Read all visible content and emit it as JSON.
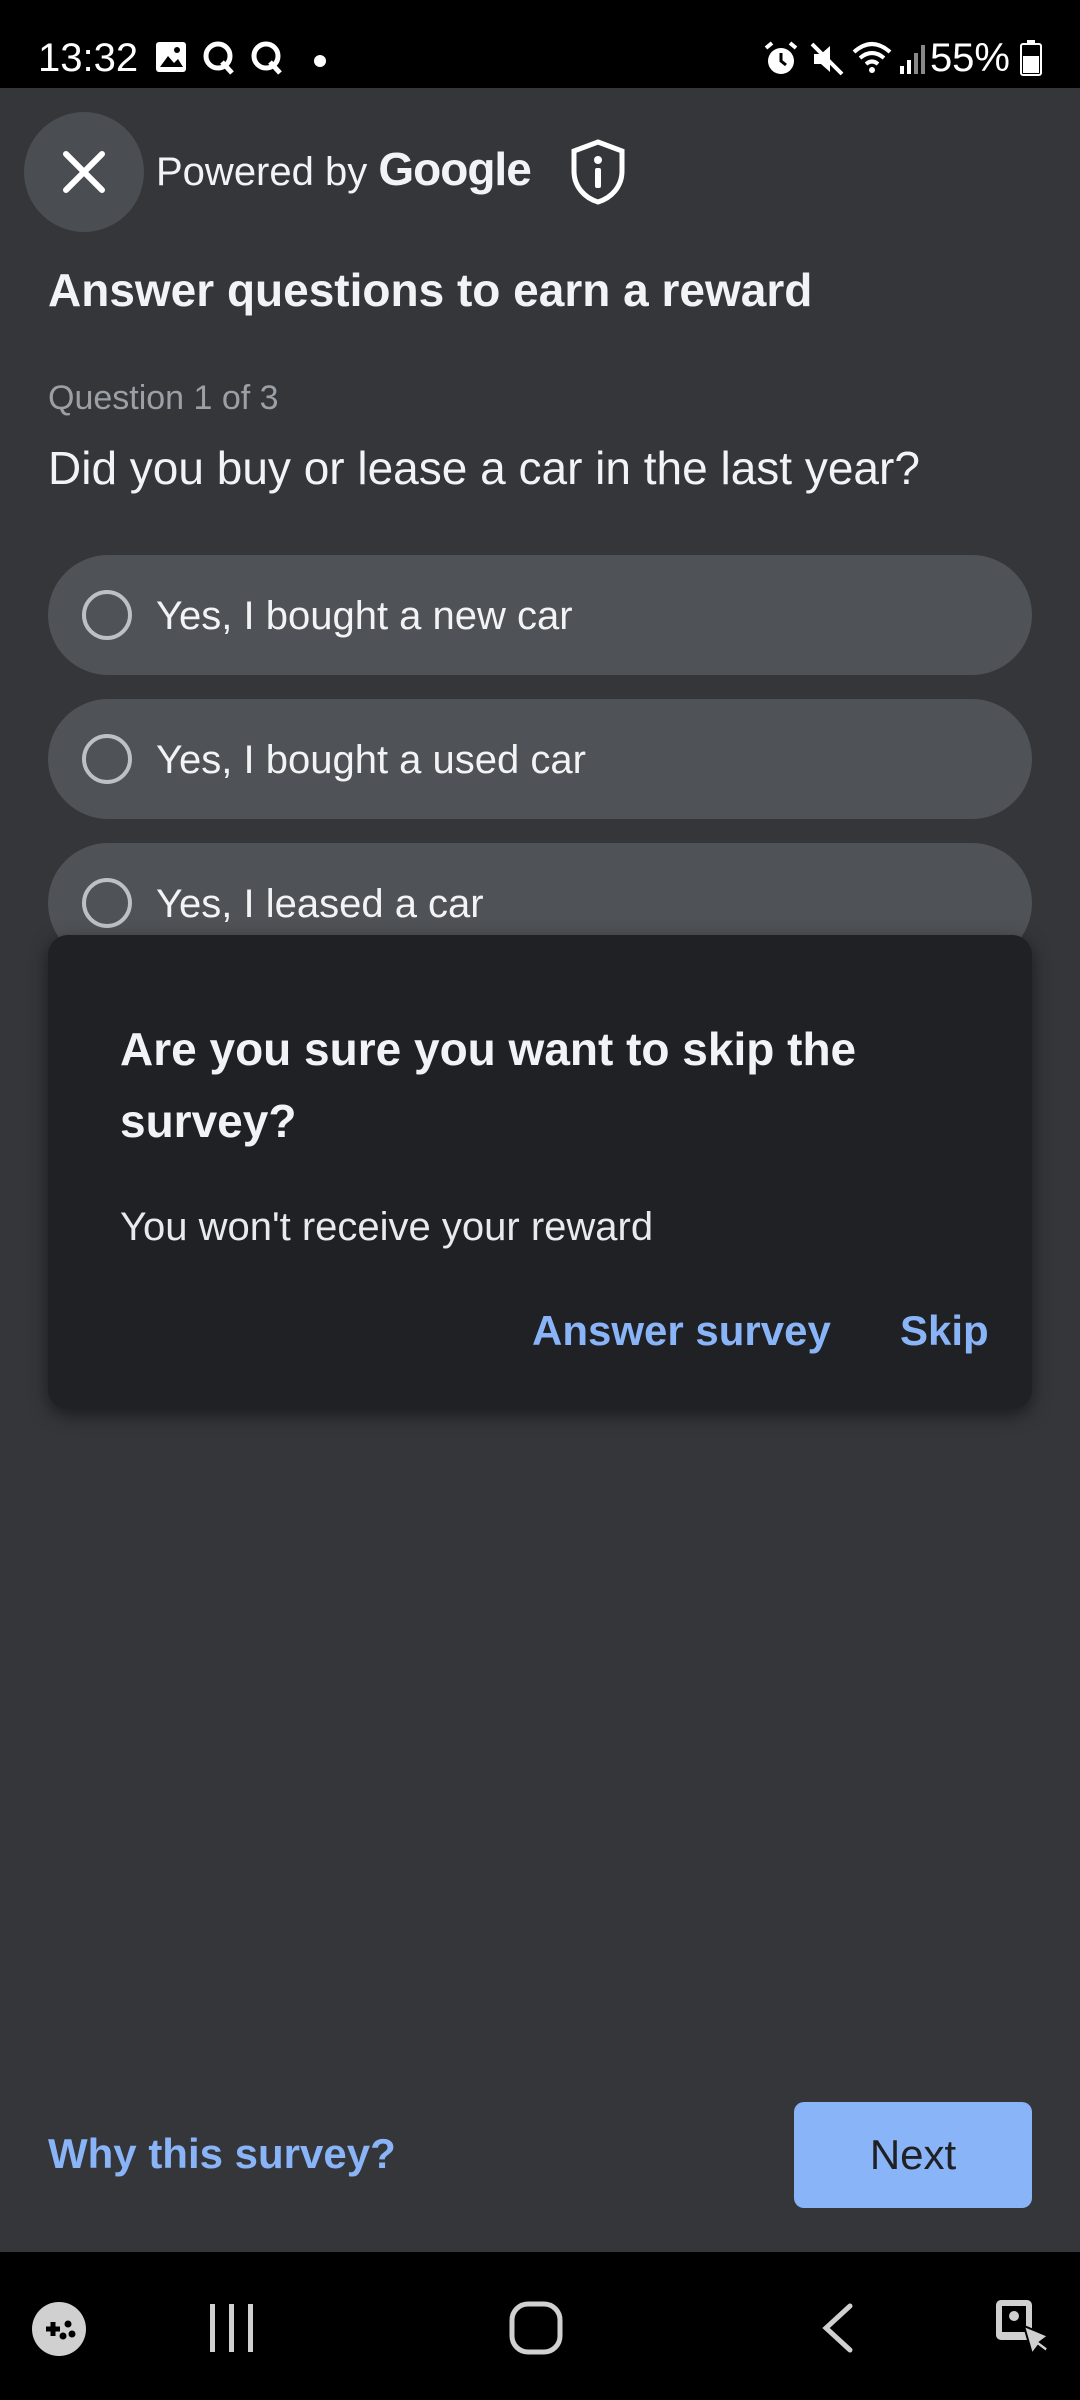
{
  "status_bar": {
    "time": "13:32",
    "battery": "55%",
    "icons": [
      "image-icon",
      "q-icon",
      "q-icon",
      "dot-icon",
      "alarm-icon",
      "mute-icon",
      "wifi-icon",
      "signal-icon",
      "battery-icon"
    ]
  },
  "header": {
    "powered_prefix": "Powered by",
    "brand": "Google",
    "close_icon": "close-icon",
    "shield_icon": "shield-info-icon"
  },
  "survey": {
    "title": "Answer questions to earn a reward",
    "progress": "Question 1 of 3",
    "question": "Did you buy or lease a car in the last year?",
    "options": [
      {
        "label": "Yes, I bought a new car"
      },
      {
        "label": "Yes, I bought a used car"
      },
      {
        "label": "Yes, I leased a car"
      }
    ]
  },
  "dialog": {
    "title": "Are you sure you want to skip the survey?",
    "body": "You won't receive your reward",
    "answer_label": "Answer survey",
    "skip_label": "Skip"
  },
  "footer": {
    "why_label": "Why this survey?",
    "next_label": "Next"
  },
  "colors": {
    "background": "#35363a",
    "accent": "#8ab4f8",
    "dialog": "#202124",
    "option": "#4f5256"
  },
  "nav_bar": {
    "icons": [
      "game-launcher-icon",
      "recents-icon",
      "home-icon",
      "back-icon",
      "assistant-touch-icon"
    ]
  }
}
